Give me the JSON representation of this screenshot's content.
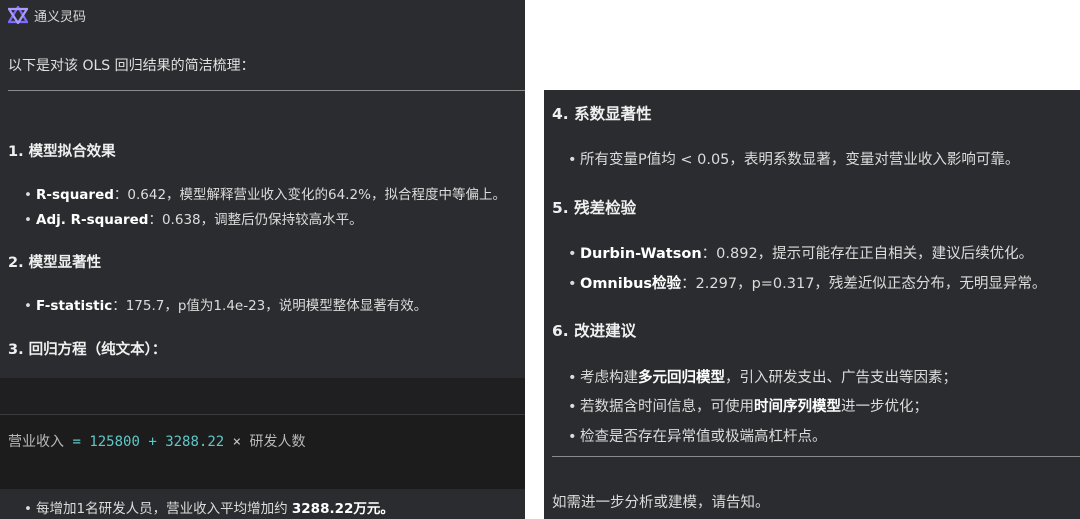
{
  "left": {
    "app_title": "通义灵码",
    "intro": "以下是对该 OLS 回归结果的简洁梳理：",
    "sections": [
      {
        "heading": "1. 模型拟合效果",
        "bullets": [
          {
            "label": "R-squared",
            "text": "：0.642，模型解释营业收入变化的64.2%，拟合程度中等偏上。"
          },
          {
            "label": "Adj. R-squared",
            "text": "：0.638，调整后仍保持较高水平。"
          }
        ]
      },
      {
        "heading": "2. 模型显著性",
        "bullets": [
          {
            "label": "F-statistic",
            "text": "：175.7，p值为1.4e-23，说明模型整体显著有效。"
          }
        ]
      },
      {
        "heading": "3. 回归方程（纯文本）：",
        "bullets": []
      }
    ],
    "code": {
      "lhs": "营业收入",
      "eq": "=",
      "intercept": "125800",
      "plus": "+",
      "coef": "3288.22",
      "times": "×",
      "rhs": "研发人数"
    },
    "footer_bullet": {
      "text": "每增加1名研发人员，营业收入平均增加约 ",
      "bold": "3288.22万元。"
    }
  },
  "right": {
    "sections": [
      {
        "heading": "4. 系数显著性",
        "bullets": [
          {
            "text": "所有变量P值均 < 0.05，表明系数显著，变量对营业收入影响可靠。"
          }
        ]
      },
      {
        "heading": "5. 残差检验",
        "bullets": [
          {
            "label": "Durbin-Watson",
            "text": "：0.892，提示可能存在正自相关，建议后续优化。"
          },
          {
            "label": "Omnibus检验",
            "text": "：2.297，p=0.317，残差近似正态分布，无明显异常。"
          }
        ]
      },
      {
        "heading": "6. 改进建议",
        "bullets": [
          {
            "pre": "考虑构建",
            "bold": "多元回归模型",
            "post": "，引入研发支出、广告支出等因素；"
          },
          {
            "pre": "若数据含时间信息，可使用",
            "bold": "时间序列模型",
            "post": "进一步优化；"
          },
          {
            "pre": "检查是否存在异常值或极端高杠杆点。",
            "bold": "",
            "post": ""
          }
        ]
      }
    ],
    "closing": "如需进一步分析或建模，请告知。"
  },
  "colors": {
    "panel_bg": "#2b2c2f",
    "code_bg": "#1c1c1d",
    "code_accent": "#5fc7c7",
    "logo_accent": "#7b6cff"
  },
  "icons": {
    "logo": "tongyi-lingma-logo-icon"
  }
}
